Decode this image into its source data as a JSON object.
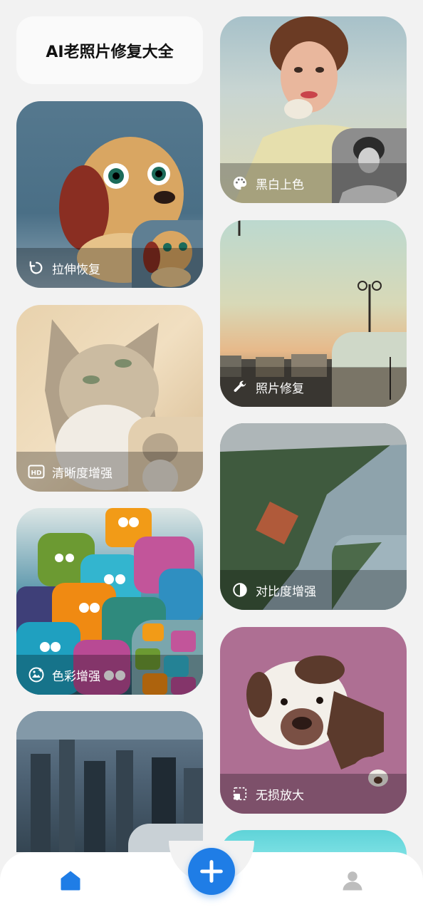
{
  "header": {
    "title": "AI老照片修复大全"
  },
  "features": [
    {
      "label": "拉伸恢复",
      "icon": "rotate-restore-icon"
    },
    {
      "label": "黑白上色",
      "icon": "palette-icon"
    },
    {
      "label": "清晰度增强",
      "icon": "hd-icon"
    },
    {
      "label": "照片修复",
      "icon": "wrench-icon"
    },
    {
      "label": "对比度增强",
      "icon": "contrast-icon"
    },
    {
      "label": "色彩增强",
      "icon": "color-enhance-icon"
    },
    {
      "label": "无损放大",
      "icon": "enlarge-icon"
    }
  ],
  "tabbar": {
    "home_icon": "home-icon",
    "add_icon": "plus-icon",
    "profile_icon": "user-icon",
    "accent": "#1f7de6"
  }
}
